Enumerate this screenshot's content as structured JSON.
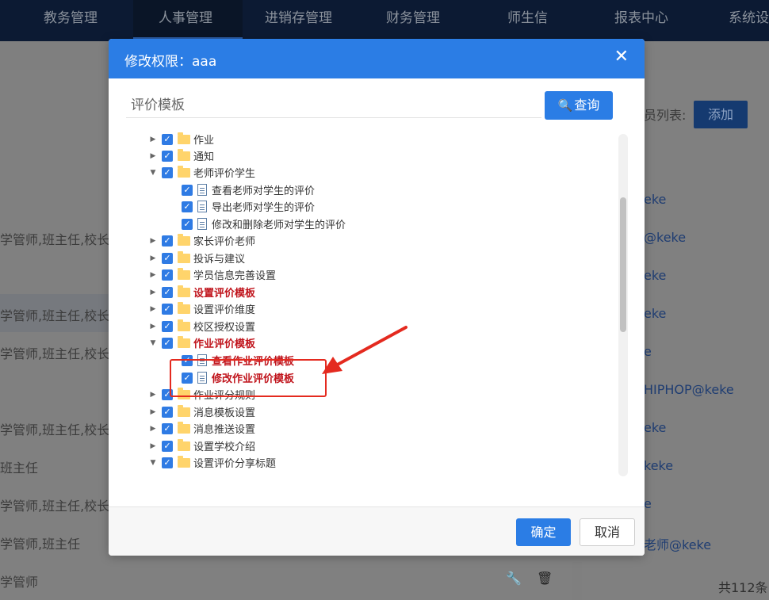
{
  "nav": {
    "items": [
      {
        "label": "教务管理",
        "active": false
      },
      {
        "label": "人事管理",
        "active": true
      },
      {
        "label": "进销存管理",
        "active": false
      },
      {
        "label": "财务管理",
        "active": false
      },
      {
        "label": "师生信",
        "active": false
      },
      {
        "label": "报表中心",
        "active": false
      },
      {
        "label": "系统设",
        "active": false
      }
    ]
  },
  "background": {
    "left_rows": [
      "学管师,班主任,校长",
      "学管师,班主任,校长",
      "学管师,班主任,校长",
      "学管师,班主任,校长",
      "班主任",
      "学管师,班主任,校长",
      "学管师,班主任",
      "学管师"
    ],
    "right_label": "员列表:",
    "add_button": "添加",
    "right_rows": [
      "eke",
      "@keke",
      "eke",
      "eke",
      "e",
      "HIPHOP@keke",
      "eke",
      "keke",
      "e",
      "老师@keke"
    ],
    "total_text": "共112条"
  },
  "modal": {
    "title": "修改权限：aaa",
    "close_icon": "close-icon",
    "search": {
      "placeholder": "评价模板",
      "value": "",
      "button_label": "查询"
    },
    "tree": [
      {
        "label": "作业",
        "type": "folder",
        "expander": "collapsed",
        "checked": true,
        "highlight": false
      },
      {
        "label": "通知",
        "type": "folder",
        "expander": "collapsed",
        "checked": true,
        "highlight": false
      },
      {
        "label": "老师评价学生",
        "type": "folder",
        "expander": "expanded",
        "checked": true,
        "highlight": false
      },
      {
        "label": "查看老师对学生的评价",
        "type": "file",
        "checked": true,
        "highlight": false
      },
      {
        "label": "导出老师对学生的评价",
        "type": "file",
        "checked": true,
        "highlight": false
      },
      {
        "label": "修改和删除老师对学生的评价",
        "type": "file",
        "checked": true,
        "highlight": false
      },
      {
        "label": "家长评价老师",
        "type": "folder",
        "expander": "collapsed",
        "checked": true,
        "highlight": false
      },
      {
        "label": "投诉与建议",
        "type": "folder",
        "expander": "collapsed",
        "checked": true,
        "highlight": false
      },
      {
        "label": "学员信息完善设置",
        "type": "folder",
        "expander": "collapsed",
        "checked": true,
        "highlight": false
      },
      {
        "label": "设置评价模板",
        "type": "folder",
        "expander": "collapsed",
        "checked": true,
        "highlight": true
      },
      {
        "label": "设置评价维度",
        "type": "folder",
        "expander": "collapsed",
        "checked": true,
        "highlight": false
      },
      {
        "label": "校区授权设置",
        "type": "folder",
        "expander": "collapsed",
        "checked": true,
        "highlight": false
      },
      {
        "label": "作业评价模板",
        "type": "folder",
        "expander": "expanded",
        "checked": true,
        "highlight": true
      },
      {
        "label": "查看作业评价模板",
        "type": "file",
        "checked": true,
        "highlight": true
      },
      {
        "label": "修改作业评价模板",
        "type": "file",
        "checked": true,
        "highlight": true
      },
      {
        "label": "作业评分规则",
        "type": "folder",
        "expander": "collapsed",
        "checked": true,
        "highlight": false
      },
      {
        "label": "消息模板设置",
        "type": "folder",
        "expander": "collapsed",
        "checked": true,
        "highlight": false
      },
      {
        "label": "消息推送设置",
        "type": "folder",
        "expander": "collapsed",
        "checked": true,
        "highlight": false
      },
      {
        "label": "设置学校介绍",
        "type": "folder",
        "expander": "collapsed",
        "checked": true,
        "highlight": false
      },
      {
        "label": "设置评价分享标题",
        "type": "folder",
        "expander": "expanded",
        "checked": true,
        "highlight": false
      }
    ],
    "footer": {
      "ok_label": "确定",
      "cancel_label": "取消"
    }
  },
  "colors": {
    "accent": "#2b7de5",
    "highlight_text": "#c0141c",
    "annotation": "#e42a1f"
  }
}
